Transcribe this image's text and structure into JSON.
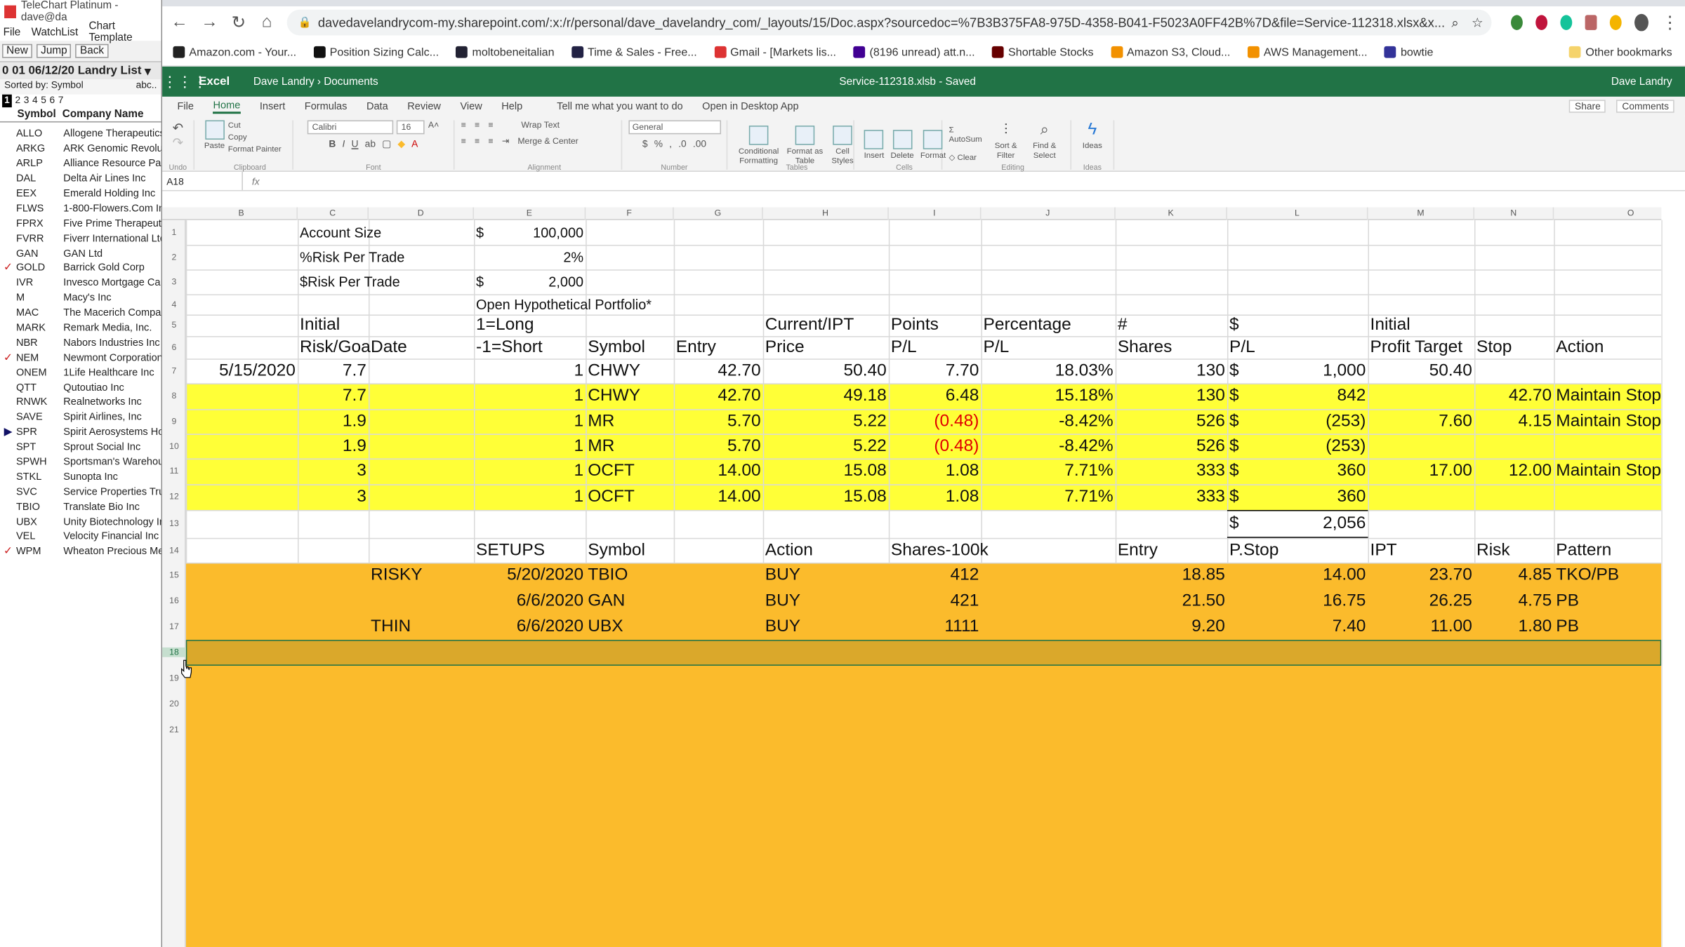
{
  "telechart": {
    "title": "TeleChart Platinum - dave@da",
    "menu": [
      "File",
      "WatchList",
      "Chart Template"
    ],
    "tools": [
      "New",
      "Jump",
      "Back"
    ],
    "list_title": "0 01 06/12/20 Landry List",
    "sorted_by": "Sorted by: Symbol",
    "sort_aux": "abc..",
    "tabs": [
      "1",
      "2",
      "3",
      "4",
      "5",
      "6",
      "7"
    ],
    "col_symbol": "Symbol",
    "col_company": "Company Name",
    "rows": [
      {
        "mark": "",
        "sym": "ALLO",
        "name": "Allogene Therapeutics"
      },
      {
        "mark": "",
        "sym": "ARKG",
        "name": "ARK Genomic Revoluti"
      },
      {
        "mark": "",
        "sym": "ARLP",
        "name": "Alliance Resource Partr"
      },
      {
        "mark": "",
        "sym": "DAL",
        "name": "Delta Air Lines Inc"
      },
      {
        "mark": "",
        "sym": "EEX",
        "name": "Emerald Holding Inc"
      },
      {
        "mark": "",
        "sym": "FLWS",
        "name": "1-800-Flowers.Com Inc"
      },
      {
        "mark": "",
        "sym": "FPRX",
        "name": "Five Prime Therapeutic"
      },
      {
        "mark": "",
        "sym": "FVRR",
        "name": "Fiverr International Ltd"
      },
      {
        "mark": "",
        "sym": "GAN",
        "name": "GAN Ltd"
      },
      {
        "mark": "✓",
        "sym": "GOLD",
        "name": "Barrick Gold Corp"
      },
      {
        "mark": "",
        "sym": "IVR",
        "name": "Invesco Mortgage Capi"
      },
      {
        "mark": "",
        "sym": "M",
        "name": "Macy's Inc"
      },
      {
        "mark": "",
        "sym": "MAC",
        "name": "The Macerich Company"
      },
      {
        "mark": "",
        "sym": "MARK",
        "name": "Remark Media, Inc."
      },
      {
        "mark": "",
        "sym": "NBR",
        "name": "Nabors Industries Inc"
      },
      {
        "mark": "✓",
        "sym": "NEM",
        "name": "Newmont Corporation"
      },
      {
        "mark": "",
        "sym": "ONEM",
        "name": "1Life Healthcare Inc"
      },
      {
        "mark": "",
        "sym": "QTT",
        "name": "Qutoutiao Inc"
      },
      {
        "mark": "",
        "sym": "RNWK",
        "name": "Realnetworks Inc"
      },
      {
        "mark": "",
        "sym": "SAVE",
        "name": "Spirit Airlines, Inc"
      },
      {
        "mark": "▶",
        "sym": "SPR",
        "name": "Spirit Aerosystems Hold"
      },
      {
        "mark": "",
        "sym": "SPT",
        "name": "Sprout Social Inc"
      },
      {
        "mark": "",
        "sym": "SPWH",
        "name": "Sportsman's Warehous"
      },
      {
        "mark": "",
        "sym": "STKL",
        "name": "Sunopta Inc"
      },
      {
        "mark": "",
        "sym": "SVC",
        "name": "Service Properties Trus"
      },
      {
        "mark": "",
        "sym": "TBIO",
        "name": "Translate Bio Inc"
      },
      {
        "mark": "",
        "sym": "UBX",
        "name": "Unity Biotechnology Inc"
      },
      {
        "mark": "",
        "sym": "VEL",
        "name": "Velocity Financial Inc"
      },
      {
        "mark": "✓",
        "sym": "WPM",
        "name": "Wheaton Precious Met"
      }
    ]
  },
  "browser": {
    "url": "davedavelandrycom-my.sharepoint.com/:x:/r/personal/dave_davelandry_com/_layouts/15/Doc.aspx?sourcedoc=%7B3B375FA8-975D-4358-B041-F5023A0FF42B%7D&file=Service-112318.xlsx&x...",
    "bookmarks": [
      "Amazon.com - Your...",
      "Position Sizing Calc...",
      "moltobeneitalian",
      "Time & Sales - Free...",
      "Gmail - [Markets lis...",
      "(8196 unread) att.n...",
      "Shortable Stocks",
      "Amazon S3, Cloud...",
      "AWS Management...",
      "bowtie"
    ],
    "other_bookmarks": "Other bookmarks"
  },
  "excel": {
    "app": "Excel",
    "breadcrumb": "Dave Landry › Documents",
    "file": "Service-112318.xlsb  -  Saved",
    "user": "Dave Landry",
    "menu": [
      "File",
      "Home",
      "Insert",
      "Formulas",
      "Data",
      "Review",
      "View",
      "Help",
      "Tell me what you want to do",
      "Open in Desktop App"
    ],
    "share": "Share",
    "comments": "Comments",
    "font_name": "Calibri",
    "font_size": "16",
    "number_format": "General",
    "name_box": "A18",
    "ribbon": {
      "paste": "Paste",
      "cut": "Cut",
      "copy": "Copy",
      "format_painter": "Format Painter",
      "wrap": "Wrap Text",
      "merge": "Merge & Center",
      "cond": "Conditional Formatting",
      "fmt_table": "Format as Table",
      "cell_styles": "Cell Styles",
      "insert": "Insert",
      "delete": "Delete",
      "format": "Format",
      "autosum": "AutoSum",
      "clear": "Clear",
      "sort": "Sort & Filter",
      "find": "Find & Select",
      "ideas": "Ideas",
      "groups": [
        "Undo",
        "Clipboard",
        "Font",
        "Alignment",
        "Number",
        "Tables",
        "Cells",
        "Editing",
        "Ideas"
      ]
    },
    "columns": [
      "B",
      "C",
      "D",
      "E",
      "F",
      "G",
      "H",
      "I",
      "J",
      "K",
      "L",
      "M",
      "N",
      "O"
    ],
    "rows": [
      "1",
      "2",
      "3",
      "4",
      "5",
      "6",
      "7",
      "8",
      "9",
      "10",
      "11",
      "12",
      "13",
      "14",
      "15",
      "16",
      "17",
      "18",
      "19",
      "20",
      "21"
    ],
    "top": {
      "account_size_label": "Account Size",
      "account_size": "100,000",
      "risk_pct_label": "%Risk Per Trade",
      "risk_pct": "2%",
      "risk_dollar_label": "$Risk Per Trade",
      "risk_dollar": "2,000",
      "dollar": "$",
      "portfolio_title": "Open Hypothetical Portfolio*"
    },
    "headers": {
      "initial": "Initial",
      "risk_goal": "Risk/Goa",
      "date": "Date",
      "long": "1=Long",
      "short": "-1=Short",
      "symbol": "Symbol",
      "entry": "Entry",
      "current_ipt": "Current/IPT",
      "price": "Price",
      "points": "Points",
      "pl": "P/L",
      "percentage": "Percentage",
      "pct_pl": "P/L",
      "hash": "#",
      "shares": "Shares",
      "dollar": "$",
      "dollar_pl": "P/L",
      "initial2": "Initial",
      "profit_target": "Profit Target",
      "stop": "Stop",
      "action": "Action"
    },
    "positions": [
      {
        "date": "5/15/2020",
        "risk": "7.7",
        "dir": "1",
        "sym": "CHWY",
        "entry": "42.70",
        "price": "50.40",
        "pts": "7.70",
        "pct": "18.03%",
        "shares": "130",
        "pl": "1,000",
        "target": "50.40",
        "stop": "",
        "action": "",
        "neg": false
      },
      {
        "date": "",
        "risk": "7.7",
        "dir": "1",
        "sym": "CHWY",
        "entry": "42.70",
        "price": "49.18",
        "pts": "6.48",
        "pct": "15.18%",
        "shares": "130",
        "pl": "842",
        "target": "",
        "stop": "42.70",
        "action": "Maintain Stop",
        "neg": false
      },
      {
        "date": "",
        "risk": "1.9",
        "dir": "1",
        "sym": "MR",
        "entry": "5.70",
        "price": "5.22",
        "pts": "(0.48)",
        "pct": "-8.42%",
        "shares": "526",
        "pl": "(253)",
        "target": "7.60",
        "stop": "4.15",
        "action": "Maintain Stop",
        "neg": true
      },
      {
        "date": "",
        "risk": "1.9",
        "dir": "1",
        "sym": "MR",
        "entry": "5.70",
        "price": "5.22",
        "pts": "(0.48)",
        "pct": "-8.42%",
        "shares": "526",
        "pl": "(253)",
        "target": "",
        "stop": "",
        "action": "",
        "neg": true
      },
      {
        "date": "",
        "risk": "3",
        "dir": "1",
        "sym": "OCFT",
        "entry": "14.00",
        "price": "15.08",
        "pts": "1.08",
        "pct": "7.71%",
        "shares": "333",
        "pl": "360",
        "target": "17.00",
        "stop": "12.00",
        "action": "Maintain Stop",
        "neg": false
      },
      {
        "date": "",
        "risk": "3",
        "dir": "1",
        "sym": "OCFT",
        "entry": "14.00",
        "price": "15.08",
        "pts": "1.08",
        "pct": "7.71%",
        "shares": "333",
        "pl": "360",
        "target": "",
        "stop": "",
        "action": "",
        "neg": false
      }
    ],
    "total_pl": "2,056",
    "setups_headers": {
      "setups": "SETUPS",
      "symbol": "Symbol",
      "action": "Action",
      "shares": "Shares-100k",
      "entry": "Entry",
      "pstop": "P.Stop",
      "ipt": "IPT",
      "risk": "Risk",
      "pattern": "Pattern"
    },
    "setups": [
      {
        "tag": "RISKY",
        "date": "5/20/2020",
        "sym": "TBIO",
        "action": "BUY",
        "shares": "412",
        "entry": "18.85",
        "pstop": "14.00",
        "ipt": "23.70",
        "risk": "4.85",
        "pattern": "TKO/PB"
      },
      {
        "tag": "",
        "date": "6/6/2020",
        "sym": "GAN",
        "action": "BUY",
        "shares": "421",
        "entry": "21.50",
        "pstop": "16.75",
        "ipt": "26.25",
        "risk": "4.75",
        "pattern": "PB"
      },
      {
        "tag": "THIN",
        "date": "6/6/2020",
        "sym": "UBX",
        "action": "BUY",
        "shares": "1111",
        "entry": "9.20",
        "pstop": "7.40",
        "ipt": "11.00",
        "risk": "1.80",
        "pattern": "PB"
      }
    ],
    "colors": {
      "yellow": "#ffff37",
      "orange": "#fbbb2c",
      "excel_green": "#217346",
      "negative": "#e00000"
    }
  }
}
